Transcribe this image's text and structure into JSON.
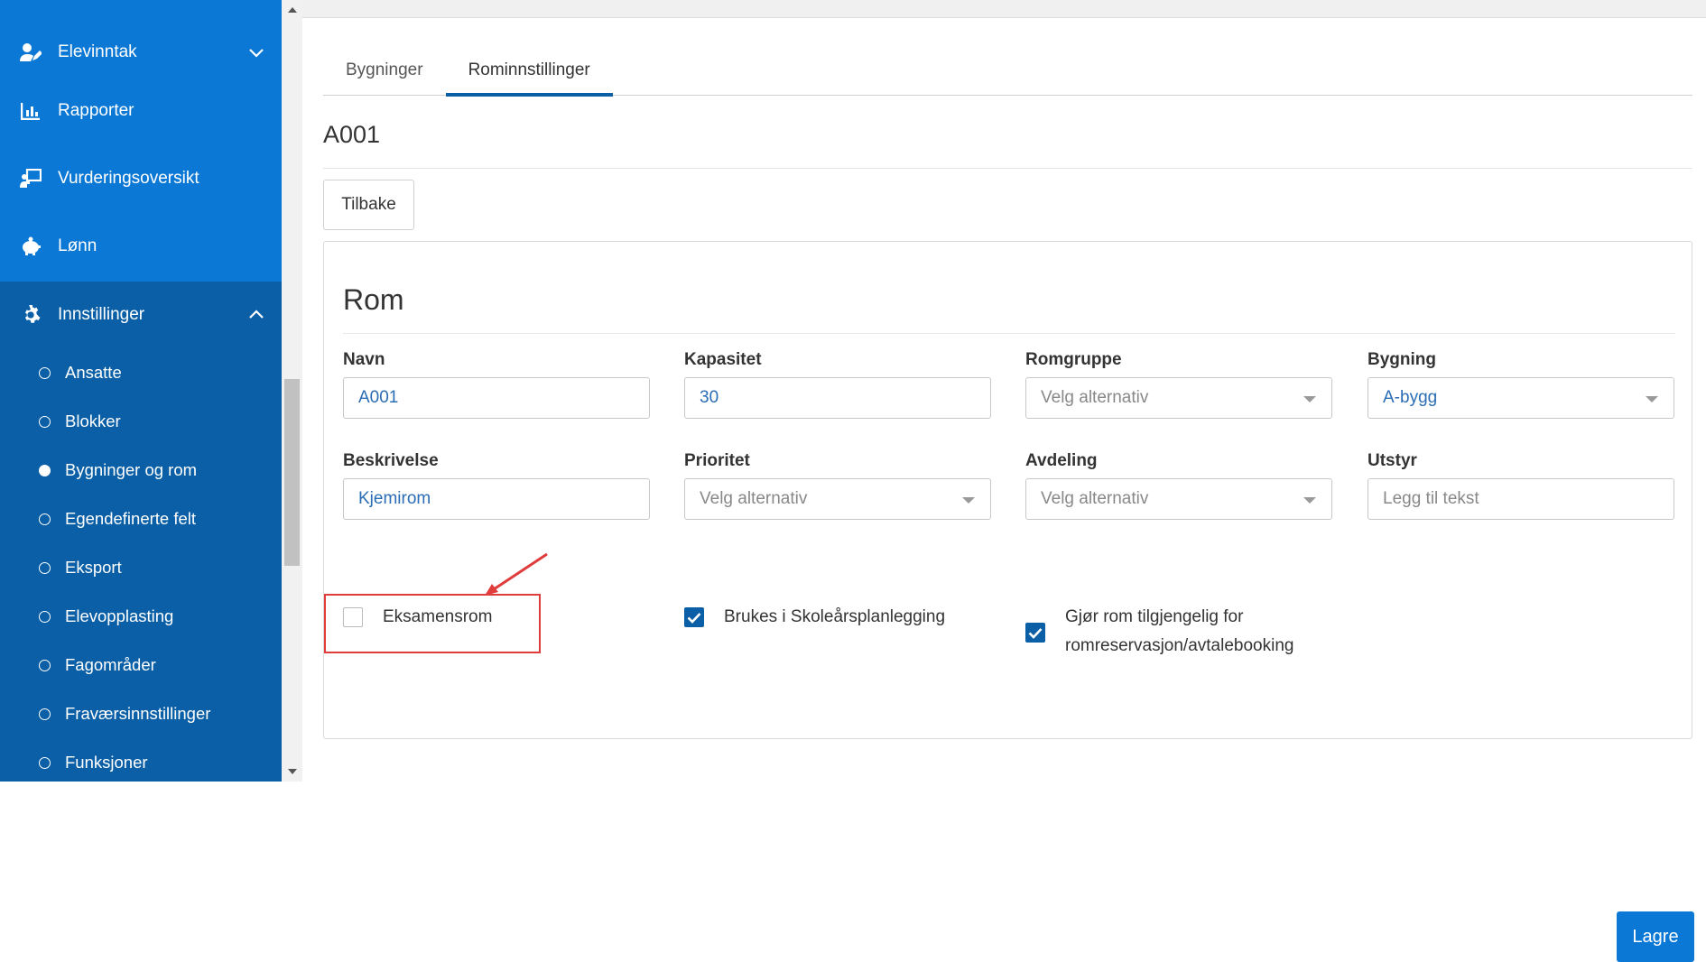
{
  "sidebar": {
    "items": [
      {
        "label": "Elevinntak",
        "icon": "user-edit-icon"
      },
      {
        "label": "Rapporter",
        "icon": "bar-chart-icon"
      },
      {
        "label": "Vurderingsoversikt",
        "icon": "presentation-icon"
      },
      {
        "label": "Lønn",
        "icon": "piggy-bank-icon"
      }
    ],
    "settings": {
      "label": "Innstillinger",
      "icon": "gear-icon",
      "sub_items": [
        {
          "label": "Ansatte",
          "active": false
        },
        {
          "label": "Blokker",
          "active": false
        },
        {
          "label": "Bygninger og rom",
          "active": true
        },
        {
          "label": "Egendefinerte felt",
          "active": false
        },
        {
          "label": "Eksport",
          "active": false
        },
        {
          "label": "Elevopplasting",
          "active": false
        },
        {
          "label": "Fagområder",
          "active": false
        },
        {
          "label": "Fraværsinnstillinger",
          "active": false
        },
        {
          "label": "Funksjoner",
          "active": false
        }
      ]
    }
  },
  "tabs": [
    {
      "label": "Bygninger",
      "active": false
    },
    {
      "label": "Rominnstillinger",
      "active": true
    }
  ],
  "page_title": "A001",
  "back_label": "Tilbake",
  "card": {
    "title": "Rom",
    "fields": {
      "navn": {
        "label": "Navn",
        "value": "A001"
      },
      "kapasitet": {
        "label": "Kapasitet",
        "value": "30"
      },
      "romgruppe": {
        "label": "Romgruppe",
        "placeholder": "Velg alternativ"
      },
      "bygning": {
        "label": "Bygning",
        "value": "A-bygg"
      },
      "beskrivelse": {
        "label": "Beskrivelse",
        "value": "Kjemirom"
      },
      "prioritet": {
        "label": "Prioritet",
        "placeholder": "Velg alternativ"
      },
      "avdeling": {
        "label": "Avdeling",
        "placeholder": "Velg alternativ"
      },
      "utstyr": {
        "label": "Utstyr",
        "placeholder": "Legg til tekst"
      }
    },
    "checkboxes": {
      "eksamensrom": {
        "label": "Eksamensrom",
        "checked": false
      },
      "skoleaar": {
        "label": "Brukes i Skoleårsplanlegging",
        "checked": true
      },
      "tilgjengelig_line1": "Gjør rom tilgjengelig for",
      "tilgjengelig_line2": "romreservasjon/avtalebooking",
      "tilgjengelig_checked": true
    },
    "save_label": "Lagre"
  },
  "colors": {
    "sidebar_bg": "#0a78d4",
    "sidebar_settings_bg": "#0a5fa6",
    "accent": "#0a5fa6",
    "annotation_red": "#e03c3c"
  }
}
